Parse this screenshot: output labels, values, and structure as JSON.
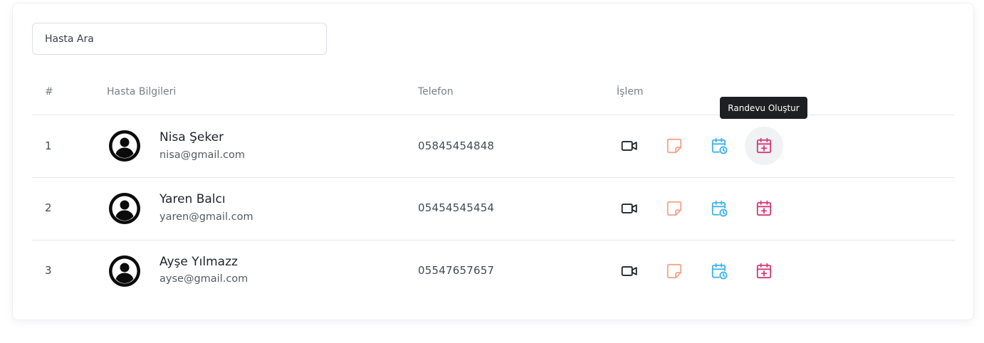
{
  "search": {
    "placeholder": "Hasta Ara",
    "value": ""
  },
  "table": {
    "headers": [
      "#",
      "Hasta Bilgileri",
      "Telefon",
      "İşlem"
    ],
    "rows": [
      {
        "index": "1",
        "name": "Nisa Şeker",
        "email": "nisa@gmail.com",
        "phone": "05845454848"
      },
      {
        "index": "2",
        "name": "Yaren Balcı",
        "email": "yaren@gmail.com",
        "phone": "05454545454"
      },
      {
        "index": "3",
        "name": "Ayşe Yılmazz",
        "email": "ayse@gmail.com",
        "phone": "05547657657"
      }
    ]
  },
  "actions": {
    "icons": [
      "video-camera-icon",
      "sticky-note-icon",
      "calendar-clock-icon",
      "calendar-plus-icon"
    ],
    "colors": {
      "video": "#1f2329",
      "note": "#f4a58a",
      "schedule": "#3fb3e8",
      "create": "#d6397a"
    }
  },
  "tooltip": {
    "text": "Randevu Oluştur"
  }
}
